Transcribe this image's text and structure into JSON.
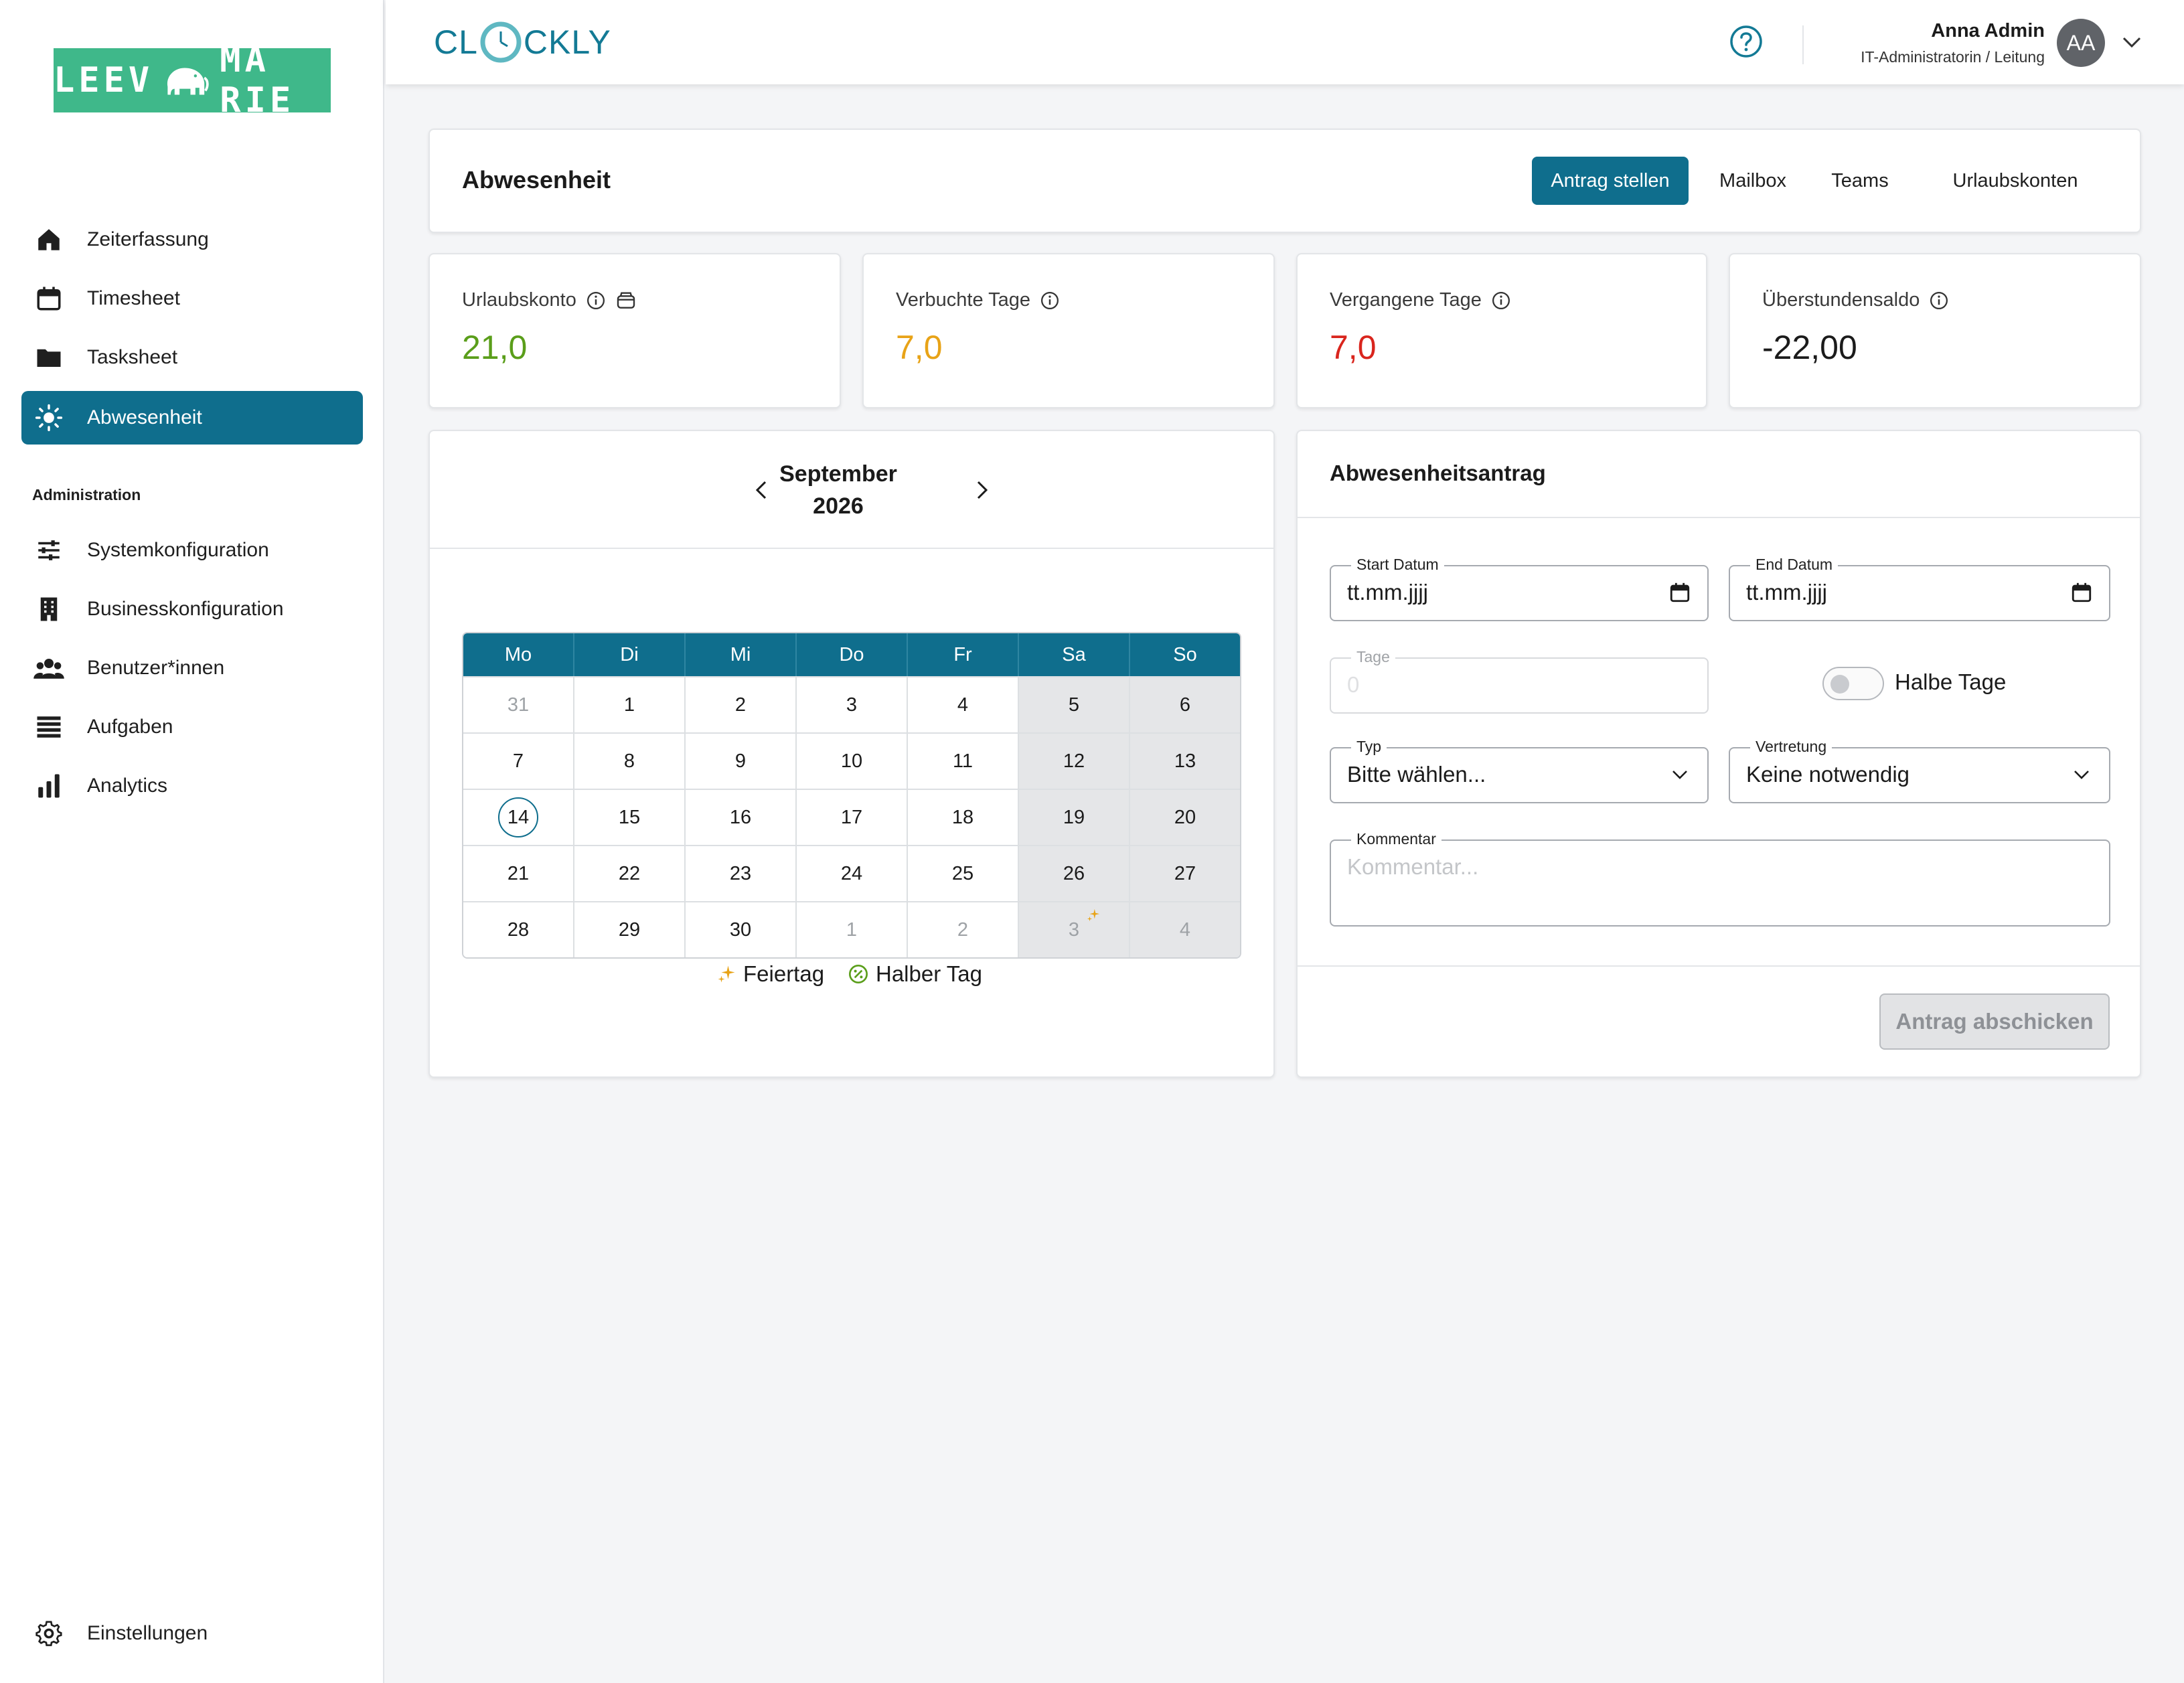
{
  "logo": {
    "left": "LEEV",
    "right": "MA RIE"
  },
  "sidebar": {
    "items": [
      {
        "label": "Zeiterfassung",
        "icon": "home-icon"
      },
      {
        "label": "Timesheet",
        "icon": "calendar-icon"
      },
      {
        "label": "Tasksheet",
        "icon": "folder-icon"
      },
      {
        "label": "Abwesenheit",
        "icon": "sun-icon",
        "active": true
      }
    ],
    "admin_title": "Administration",
    "admin_items": [
      {
        "label": "Systemkonfiguration",
        "icon": "sliders-icon"
      },
      {
        "label": "Businesskonfiguration",
        "icon": "building-icon"
      },
      {
        "label": "Benutzer*innen",
        "icon": "users-icon"
      },
      {
        "label": "Aufgaben",
        "icon": "list-icon"
      },
      {
        "label": "Analytics",
        "icon": "bar-chart-icon"
      }
    ],
    "settings": {
      "label": "Einstellungen",
      "icon": "gear-icon"
    }
  },
  "header": {
    "brand_left": "CL",
    "brand_right": "CKLY",
    "user_name": "Anna Admin",
    "user_role": "IT-Administratorin / Leitung",
    "avatar_initials": "AA"
  },
  "page": {
    "title": "Abwesenheit",
    "tabs": [
      {
        "label": "Antrag stellen",
        "primary": true
      },
      {
        "label": "Mailbox"
      },
      {
        "label": "Teams"
      },
      {
        "label": "Urlaubskonten"
      }
    ]
  },
  "stats": [
    {
      "label": "Urlaubskonto",
      "value": "21,0",
      "color": "#5a9e1a"
    },
    {
      "label": "Verbuchte Tage",
      "value": "7,0",
      "color": "#e8a317"
    },
    {
      "label": "Vergangene Tage",
      "value": "7,0",
      "color": "#d9251d"
    },
    {
      "label": "Überstundensaldo",
      "value": "-22,00",
      "color": "#1b1b1b"
    }
  ],
  "calendar": {
    "month": "September",
    "year": "2026",
    "weekdays": [
      "Mo",
      "Di",
      "Mi",
      "Do",
      "Fr",
      "Sa",
      "So"
    ],
    "weeks": [
      [
        "31",
        "1",
        "2",
        "3",
        "4",
        "5",
        "6"
      ],
      [
        "7",
        "8",
        "9",
        "10",
        "11",
        "12",
        "13"
      ],
      [
        "14",
        "15",
        "16",
        "17",
        "18",
        "19",
        "20"
      ],
      [
        "21",
        "22",
        "23",
        "24",
        "25",
        "26",
        "27"
      ],
      [
        "28",
        "29",
        "30",
        "1",
        "2",
        "3",
        "4"
      ]
    ],
    "today": "14",
    "legend": {
      "holiday": "Feiertag",
      "half_day": "Halber Tag"
    }
  },
  "form": {
    "title": "Abwesenheitsantrag",
    "start_label": "Start Datum",
    "start_value": "tt.mm.jjjj",
    "end_label": "End Datum",
    "end_value": "tt.mm.jjjj",
    "days_label": "Tage",
    "days_placeholder": "0",
    "half_days_label": "Halbe Tage",
    "type_label": "Typ",
    "type_value": "Bitte wählen...",
    "rep_label": "Vertretung",
    "rep_value": "Keine notwendig",
    "comment_label": "Kommentar",
    "comment_placeholder": "Kommentar...",
    "submit_label": "Antrag abschicken"
  },
  "colors": {
    "accent": "#0f6e8d",
    "brand_green": "#3fb88a",
    "holiday": "#e8a317",
    "half_day": "#5a9e1a"
  }
}
